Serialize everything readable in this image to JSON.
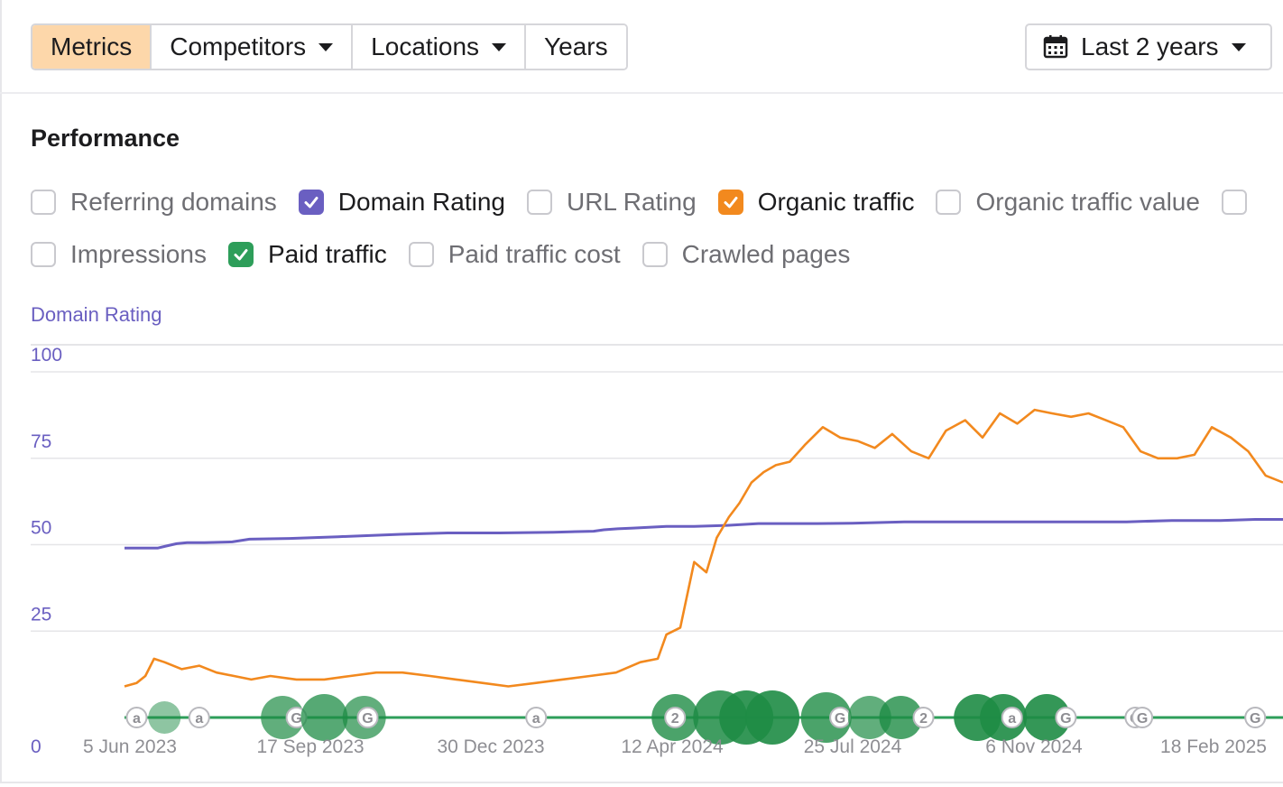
{
  "toolbar": {
    "tabs": [
      {
        "label": "Metrics",
        "active": true,
        "dropdown": false
      },
      {
        "label": "Competitors",
        "active": false,
        "dropdown": true
      },
      {
        "label": "Locations",
        "active": false,
        "dropdown": true
      },
      {
        "label": "Years",
        "active": false,
        "dropdown": false
      }
    ],
    "range": {
      "label": "Last 2 years",
      "icon": "calendar-icon"
    }
  },
  "section": {
    "title": "Performance"
  },
  "metrics": {
    "row1": [
      {
        "label": "Referring domains",
        "checked": false,
        "color": ""
      },
      {
        "label": "Domain Rating",
        "checked": true,
        "color": "#6a5fc1"
      },
      {
        "label": "URL Rating",
        "checked": false,
        "color": ""
      },
      {
        "label": "Organic traffic",
        "checked": true,
        "color": "#f2891e"
      },
      {
        "label": "Organic traffic value",
        "checked": false,
        "color": ""
      },
      {
        "label": "",
        "checked": false,
        "color": ""
      }
    ],
    "row2": [
      {
        "label": "Impressions",
        "checked": false,
        "color": ""
      },
      {
        "label": "Paid traffic",
        "checked": true,
        "color": "#2e9e5a"
      },
      {
        "label": "Paid traffic cost",
        "checked": false,
        "color": ""
      },
      {
        "label": "Crawled pages",
        "checked": false,
        "color": ""
      }
    ]
  },
  "colors": {
    "accent": "#fdd7aa",
    "domain_rating": "#6a5fc1",
    "organic": "#f2891e",
    "paid": "#2e9e5a",
    "grid": "#e5e5e8"
  },
  "chart_data": {
    "type": "line",
    "ylabel": "Domain Rating",
    "ylim": [
      0,
      100
    ],
    "y_ticks": [
      0,
      25,
      50,
      75,
      100
    ],
    "x_tick_labels": [
      "5 Jun 2023",
      "17 Sep 2023",
      "30 Dec 2023",
      "12 Apr 2024",
      "25 Jul 2024",
      "6 Nov 2024",
      "18 Feb 2025"
    ],
    "x_range": [
      "2023-05-13",
      "2025-03-10"
    ],
    "grid": true,
    "series": [
      {
        "name": "Domain Rating",
        "color": "#6a5fc1",
        "x": [
          "2023-05-13",
          "2023-06-01",
          "2023-06-06",
          "2023-06-12",
          "2023-06-18",
          "2023-06-28",
          "2023-07-14",
          "2023-07-24",
          "2023-08-16",
          "2023-09-13",
          "2023-10-19",
          "2023-11-15",
          "2023-12-15",
          "2024-01-15",
          "2024-02-07",
          "2024-02-13",
          "2024-02-21",
          "2024-03-01",
          "2024-03-20",
          "2024-04-05",
          "2024-04-24",
          "2024-05-12",
          "2024-06-15",
          "2024-07-05",
          "2024-08-04",
          "2024-08-23",
          "2024-09-02",
          "2024-09-21",
          "2024-10-09",
          "2024-11-09",
          "2024-12-10",
          "2025-01-05",
          "2025-02-02",
          "2025-02-22",
          "2025-03-10"
        ],
        "values": [
          49,
          49,
          49.6,
          50.3,
          50.6,
          50.6,
          50.8,
          51.6,
          51.8,
          52.3,
          53,
          53.4,
          53.4,
          53.6,
          53.9,
          54.3,
          54.6,
          54.8,
          55.3,
          55.3,
          55.6,
          56.1,
          56.1,
          56.2,
          56.6,
          56.6,
          56.6,
          56.6,
          56.6,
          56.6,
          56.6,
          57,
          57,
          57.3,
          57.3
        ]
      },
      {
        "name": "Organic traffic",
        "color": "#f2891e",
        "x": [
          "2023-05-13",
          "2023-05-20",
          "2023-05-25",
          "2023-05-30",
          "2023-06-05",
          "2023-06-15",
          "2023-06-25",
          "2023-07-05",
          "2023-07-15",
          "2023-07-25",
          "2023-08-05",
          "2023-08-20",
          "2023-09-05",
          "2023-09-20",
          "2023-10-05",
          "2023-10-20",
          "2023-11-05",
          "2023-11-20",
          "2023-12-05",
          "2023-12-20",
          "2024-01-05",
          "2024-01-20",
          "2024-02-05",
          "2024-02-20",
          "2024-03-05",
          "2024-03-15",
          "2024-03-20",
          "2024-03-28",
          "2024-04-05",
          "2024-04-12",
          "2024-04-18",
          "2024-04-25",
          "2024-05-01",
          "2024-05-08",
          "2024-05-15",
          "2024-05-22",
          "2024-05-30",
          "2024-06-08",
          "2024-06-18",
          "2024-06-28",
          "2024-07-08",
          "2024-07-18",
          "2024-07-28",
          "2024-08-08",
          "2024-08-18",
          "2024-08-28",
          "2024-09-08",
          "2024-09-18",
          "2024-09-28",
          "2024-10-08",
          "2024-10-18",
          "2024-10-28",
          "2024-11-08",
          "2024-11-18",
          "2024-11-28",
          "2024-12-08",
          "2024-12-18",
          "2024-12-28",
          "2025-01-08",
          "2025-01-18",
          "2025-01-28",
          "2025-02-08",
          "2025-02-18",
          "2025-02-28",
          "2025-03-10"
        ],
        "values": [
          9,
          10,
          12,
          17,
          16,
          14,
          15,
          13,
          12,
          11,
          12,
          11,
          11,
          12,
          13,
          13,
          12,
          11,
          10,
          9,
          10,
          11,
          12,
          13,
          16,
          17,
          24,
          26,
          45,
          42,
          52,
          58,
          62,
          68,
          71,
          73,
          74,
          79,
          84,
          81,
          80,
          78,
          82,
          77,
          75,
          83,
          86,
          81,
          88,
          85,
          89,
          88,
          87,
          88,
          86,
          84,
          77,
          75,
          75,
          76,
          84,
          81,
          77,
          70,
          68
        ]
      },
      {
        "name": "Paid traffic",
        "color": "#2e9e5a",
        "x": [
          "2023-05-13",
          "2025-03-10"
        ],
        "values": [
          0,
          0
        ]
      }
    ],
    "annotations": [
      {
        "type": "marker",
        "label": "a",
        "date": "2023-05-20"
      },
      {
        "type": "bubble",
        "date": "2023-06-05",
        "size": 18,
        "opacity": 0.5
      },
      {
        "type": "marker",
        "label": "a",
        "date": "2023-06-25"
      },
      {
        "type": "bubble",
        "date": "2023-08-12",
        "size": 24,
        "opacity": 0.7
      },
      {
        "type": "marker",
        "label": "G",
        "date": "2023-08-20"
      },
      {
        "type": "bubble",
        "date": "2023-09-05",
        "size": 26,
        "opacity": 0.75
      },
      {
        "type": "bubble",
        "date": "2023-09-28",
        "size": 24,
        "opacity": 0.7
      },
      {
        "type": "marker",
        "label": "G",
        "date": "2023-09-30"
      },
      {
        "type": "marker",
        "label": "a",
        "date": "2024-01-05"
      },
      {
        "type": "bubble",
        "date": "2024-03-25",
        "size": 26,
        "opacity": 0.8
      },
      {
        "type": "marker",
        "label": "2",
        "date": "2024-03-25"
      },
      {
        "type": "bubble",
        "date": "2024-04-20",
        "size": 30,
        "opacity": 0.85
      },
      {
        "type": "bubble",
        "date": "2024-05-05",
        "size": 30,
        "opacity": 0.9
      },
      {
        "type": "bubble",
        "date": "2024-05-20",
        "size": 30,
        "opacity": 0.9
      },
      {
        "type": "bubble",
        "date": "2024-06-20",
        "size": 28,
        "opacity": 0.8
      },
      {
        "type": "marker",
        "label": "G",
        "date": "2024-06-28"
      },
      {
        "type": "bubble",
        "date": "2024-07-15",
        "size": 24,
        "opacity": 0.7
      },
      {
        "type": "bubble",
        "date": "2024-08-02",
        "size": 24,
        "opacity": 0.8
      },
      {
        "type": "marker",
        "label": "2",
        "date": "2024-08-15"
      },
      {
        "type": "bubble",
        "date": "2024-09-15",
        "size": 26,
        "opacity": 0.9
      },
      {
        "type": "bubble",
        "date": "2024-09-30",
        "size": 26,
        "opacity": 0.9
      },
      {
        "type": "marker",
        "label": "a",
        "date": "2024-10-05"
      },
      {
        "type": "bubble",
        "date": "2024-10-25",
        "size": 26,
        "opacity": 0.9
      },
      {
        "type": "marker",
        "label": "G",
        "date": "2024-11-05"
      },
      {
        "type": "marker",
        "label": "G",
        "date": "2024-12-15"
      },
      {
        "type": "marker",
        "label": "G",
        "date": "2024-12-19"
      },
      {
        "type": "marker",
        "label": "G",
        "date": "2025-02-22"
      }
    ]
  }
}
